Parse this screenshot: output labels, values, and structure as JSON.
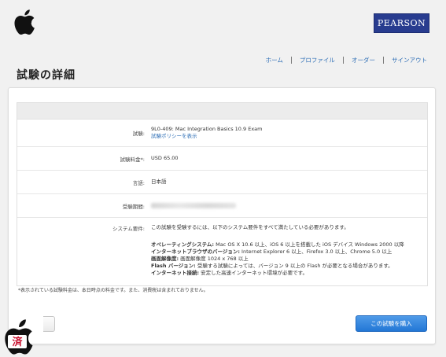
{
  "header": {
    "brand": "PEARSON",
    "nav": [
      "ホーム",
      "プロファイル",
      "オーダー",
      "サインアウト"
    ]
  },
  "page_title": "試験の詳細",
  "exam": {
    "rows": [
      {
        "label": "試験:",
        "value": "9L0-409: Mac Integration Basics 10.9 Exam",
        "link": "試験ポリシーを表示"
      },
      {
        "label": "試験料金*:",
        "value": "USD 65.00"
      },
      {
        "label": "言語:",
        "value": "日本語"
      },
      {
        "label": "受験期間:",
        "value": ""
      },
      {
        "label": "システム要件:",
        "value": "この試験を受験するには、以下のシステム要件をすべて満たしている必要があります。"
      }
    ],
    "requirements": [
      {
        "term": "オペレーティングシステム:",
        "text": " Mac OS X 10.6 以上、iOS 6 以上を搭載した iOS デバイス Windows 2000 以降"
      },
      {
        "term": "インターネットブラウザのバージョン:",
        "text": " Internet Explorer 6 以上、Firefox 3.0 以上、Chrome 5.0 以上"
      },
      {
        "term": "画面解像度:",
        "text": " 画面解像度 1024 x 768 以上"
      },
      {
        "term": "Flash バージョン:",
        "text": " 受験する試験によっては、バージョン 9 以上の Flash が必要となる場合があります。"
      },
      {
        "term": "インターネット接続:",
        "text": " 安定した高速インターネット環境が必要です。"
      }
    ]
  },
  "footnote": "*表示されている試験料金は、本日時点の料金です。また、消費税は含まれておりません。",
  "buy_button": "この試験を購入",
  "badge_text": "済",
  "colors": {
    "accent": "#2377d6",
    "brand": "#283c8f",
    "link": "#2f6fb6"
  }
}
